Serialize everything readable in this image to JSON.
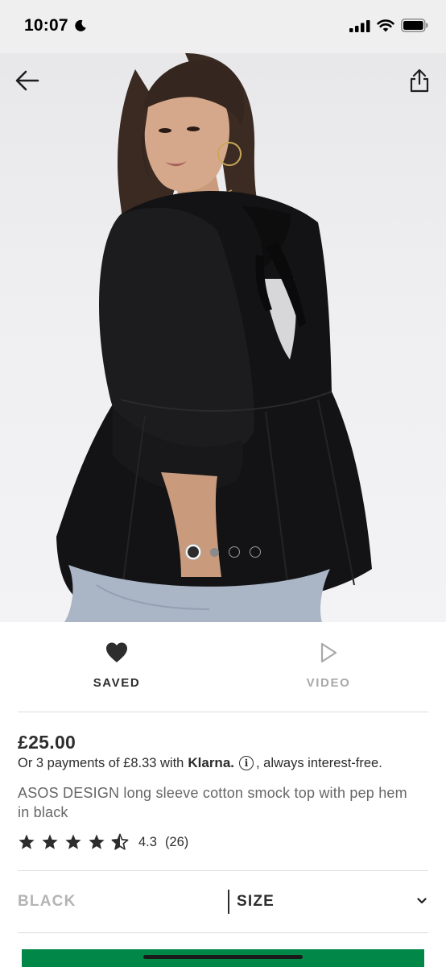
{
  "status_bar": {
    "time": "10:07"
  },
  "gallery": {
    "image_alt": "Model wearing black smock top with puff sleeves and tie back",
    "dot_count": 4,
    "active_index": 0
  },
  "actions": {
    "saved_label": "SAVED",
    "video_label": "VIDEO"
  },
  "product": {
    "price": "£25.00",
    "klarna_prefix": "Or 3 payments of £8.33 with",
    "klarna_brand": "Klarna.",
    "klarna_suffix": ", always interest-free.",
    "title": "ASOS DESIGN long sleeve cotton smock top with pep hem in black",
    "rating_value": "4.3",
    "rating_count": "(26)",
    "rating_stars": 4.3
  },
  "variant": {
    "colour": "BLACK",
    "size_label": "SIZE"
  },
  "colors": {
    "primary_text": "#2d2d2d",
    "muted_text": "#a8a8a8",
    "add_to_bag": "#018849"
  }
}
